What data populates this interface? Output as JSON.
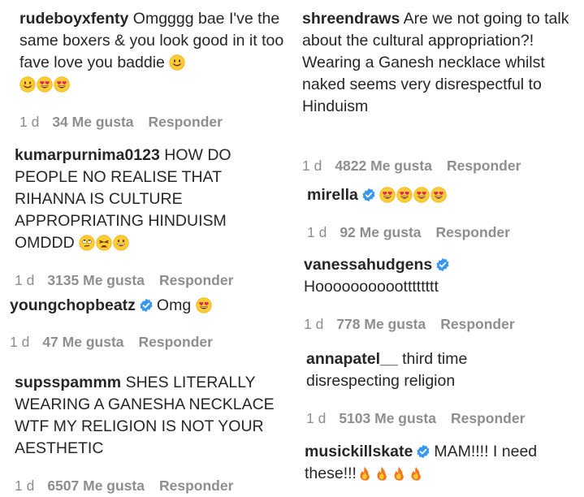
{
  "comments": [
    {
      "username": "rudeboyxfenty",
      "verified": false,
      "text": "Omgggg bae I've the same boxers & you look good in it too fave love you baddie",
      "emojis": [
        "smiling-face",
        "smiling-face",
        "heart-eyes",
        "heart-eyes"
      ],
      "time": "1 d",
      "likes": "34 Me gusta",
      "reply": "Responder"
    },
    {
      "username": "kumarpurnima0123",
      "verified": false,
      "text": "HOW DO PEOPLE NO REALISE THAT RIHANNA IS CULTURE APPROPRIATING HINDUISM OMDDD",
      "emojis": [
        "eye-roll",
        "weary",
        "grinning"
      ],
      "time": "1 d",
      "likes": "3135 Me gusta",
      "reply": "Responder"
    },
    {
      "username": "youngchopbeatz",
      "verified": true,
      "text": "Omg",
      "emojis": [
        "heart-eyes"
      ],
      "time": "1 d",
      "likes": "47 Me gusta",
      "reply": "Responder"
    },
    {
      "username": "supsspammm",
      "verified": false,
      "text": "SHES LITERALLY WEARING A GANESHA NECKLACE WTF MY RELIGION IS NOT YOUR AESTHETIC",
      "emojis": [],
      "time": "1 d",
      "likes": "6507 Me gusta",
      "reply": "Responder"
    },
    {
      "username": "shreendraws",
      "verified": false,
      "text": "Are we not going to talk about the cultural appropriation?! Wearing a Ganesh necklace whilst naked seems very disrespectful to Hinduism",
      "emojis": [],
      "time": "1 d",
      "likes": "4822 Me gusta",
      "reply": "Responder"
    },
    {
      "username": "mirella",
      "verified": true,
      "text": "",
      "emojis": [
        "heart-eyes",
        "heart-eyes",
        "heart-eyes",
        "heart-eyes"
      ],
      "time": "1 d",
      "likes": "92 Me gusta",
      "reply": "Responder"
    },
    {
      "username": "vanessahudgens",
      "verified": true,
      "text": "Hooooooooootttttttt",
      "emojis": [],
      "time": "1 d",
      "likes": "778 Me gusta",
      "reply": "Responder"
    },
    {
      "username": "annapatel__",
      "verified": false,
      "text": "third time disrespecting religion",
      "emojis": [],
      "time": "1 d",
      "likes": "5103 Me gusta",
      "reply": "Responder"
    },
    {
      "username": "musickillskate",
      "verified": true,
      "text": "MAM!!!! I need these!!!",
      "emojis": [
        "fire",
        "fire",
        "fire",
        "fire"
      ],
      "time": "",
      "likes": "",
      "reply": ""
    }
  ]
}
